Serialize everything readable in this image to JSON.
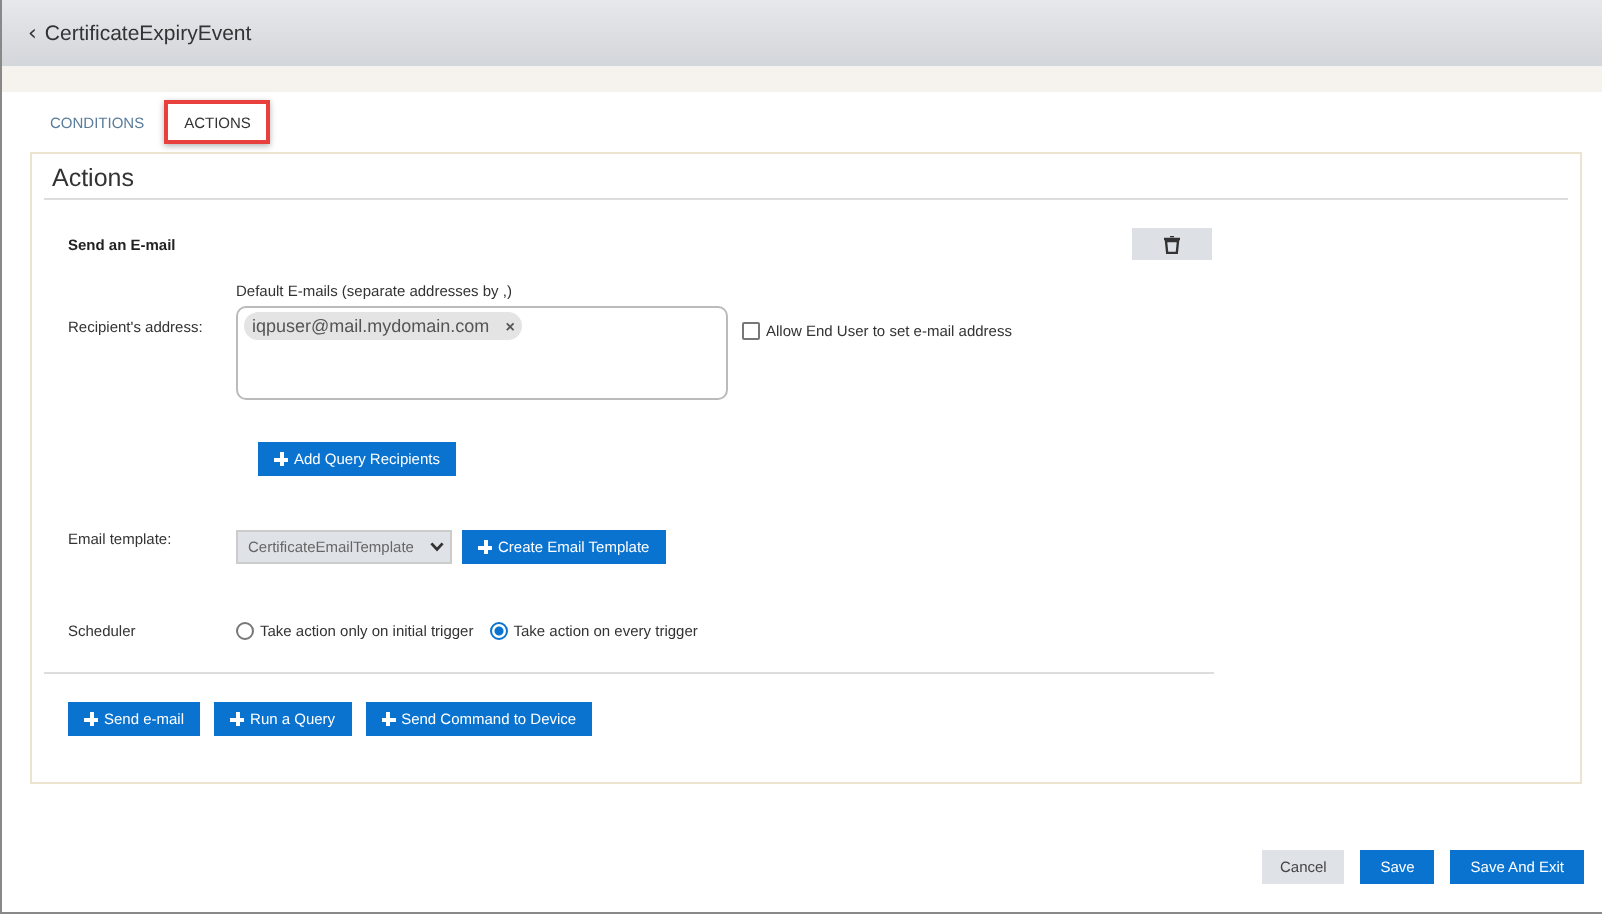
{
  "header": {
    "back": "‹",
    "title": "CertificateExpiryEvent"
  },
  "tabs": [
    {
      "label": "CONDITIONS",
      "selected": false,
      "highlighted": false
    },
    {
      "label": "ACTIONS",
      "selected": true,
      "highlighted": true
    }
  ],
  "panel": {
    "title": "Actions",
    "section_title": "Send an E-mail",
    "recipients": {
      "hint": "Default E-mails (separate addresses by ,)",
      "label": "Recipient's address:",
      "tags": [
        "iqpuser@mail.mydomain.com"
      ],
      "tag_remove": "×",
      "allow_end_user": {
        "label": "Allow End User to set e-mail address",
        "checked": false
      }
    },
    "add_query_button": "Add Query Recipients",
    "template": {
      "label": "Email template:",
      "value": "CertificateEmailTemplate",
      "create_button": "Create Email Template"
    },
    "scheduler": {
      "label": "Scheduler",
      "options": [
        {
          "label": "Take action only on initial trigger",
          "selected": false
        },
        {
          "label": "Take action on every trigger",
          "selected": true
        }
      ]
    },
    "action_buttons": [
      "Send e-mail",
      "Run a Query",
      "Send Command to Device"
    ]
  },
  "footer_buttons": [
    {
      "label": "Cancel",
      "kind": "secondary"
    },
    {
      "label": "Save",
      "kind": "primary"
    },
    {
      "label": "Save And Exit",
      "kind": "primary"
    }
  ]
}
